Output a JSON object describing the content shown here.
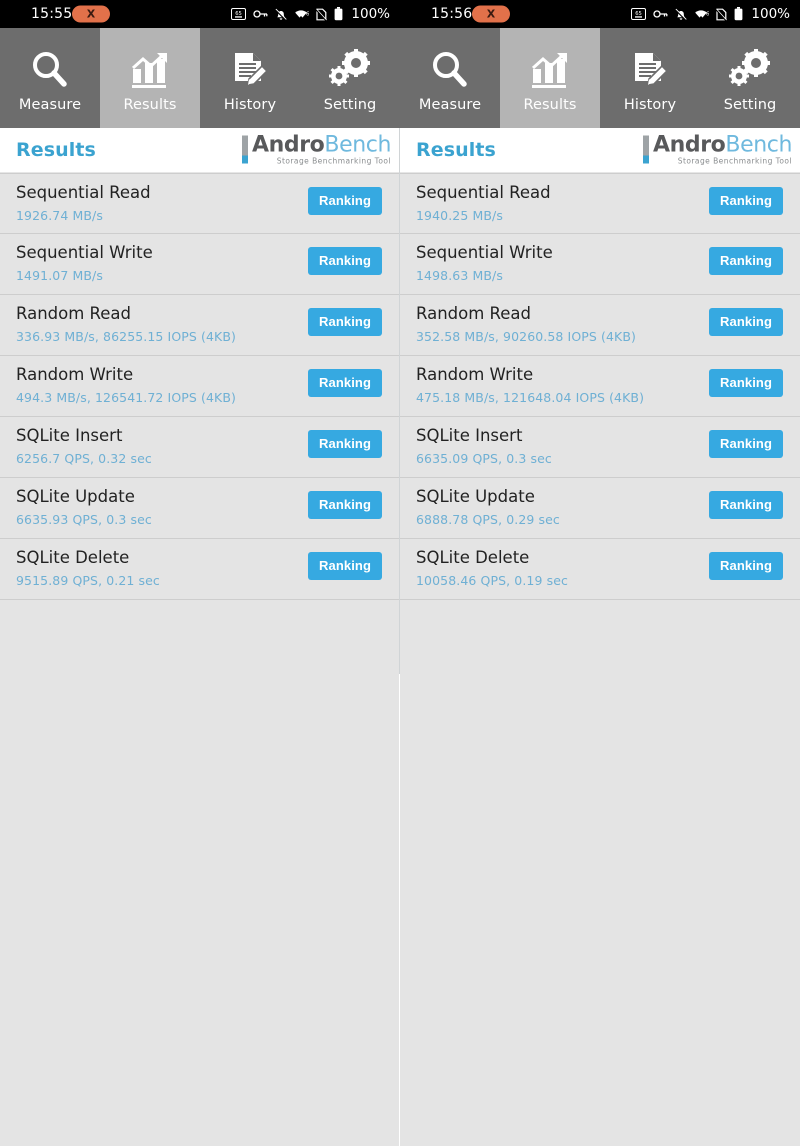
{
  "statusbar": {
    "left": {
      "time": "15:55",
      "pill_glyph": "X",
      "battery": "100%"
    },
    "right": {
      "time": "15:56",
      "pill_glyph": "X",
      "battery": "100%"
    },
    "icons": [
      "subtitle-icon",
      "key-icon",
      "notifications-off-icon",
      "wifi-icon",
      "sim-off-icon",
      "battery-icon"
    ]
  },
  "tabs": [
    {
      "label": "Measure",
      "icon": "magnifier-icon",
      "active": false
    },
    {
      "label": "Results",
      "icon": "bar-chart-icon",
      "active": true
    },
    {
      "label": "History",
      "icon": "document-pencil-icon",
      "active": false
    },
    {
      "label": "Setting",
      "icon": "gears-icon",
      "active": false
    },
    {
      "label": "Measure",
      "icon": "magnifier-icon",
      "active": false
    },
    {
      "label": "Results",
      "icon": "bar-chart-icon",
      "active": true
    },
    {
      "label": "History",
      "icon": "document-pencil-icon",
      "active": false
    },
    {
      "label": "Setting",
      "icon": "gears-icon",
      "active": false
    }
  ],
  "logo": {
    "word_a": "Andro",
    "word_b": "Bench",
    "subtitle": "Storage Benchmarking Tool"
  },
  "colors": {
    "accent": "#36a9e1",
    "value_text": "#6fb0d4",
    "title": "#3ba3d0",
    "tab_bg": "#6d6d6d",
    "tab_active_bg": "#b4b4b4",
    "row_bg": "#e4e4e4"
  },
  "panels": [
    {
      "title": "Results",
      "rank_label": "Ranking",
      "rows": [
        {
          "name": "Sequential Read",
          "value": "1926.74 MB/s"
        },
        {
          "name": "Sequential Write",
          "value": "1491.07 MB/s"
        },
        {
          "name": "Random Read",
          "value": "336.93 MB/s, 86255.15 IOPS (4KB)"
        },
        {
          "name": "Random Write",
          "value": "494.3 MB/s, 126541.72 IOPS (4KB)"
        },
        {
          "name": "SQLite Insert",
          "value": "6256.7 QPS, 0.32 sec"
        },
        {
          "name": "SQLite Update",
          "value": "6635.93 QPS, 0.3 sec"
        },
        {
          "name": "SQLite Delete",
          "value": "9515.89 QPS, 0.21 sec"
        }
      ]
    },
    {
      "title": "Results",
      "rank_label": "Ranking",
      "rows": [
        {
          "name": "Sequential Read",
          "value": "1940.25 MB/s"
        },
        {
          "name": "Sequential Write",
          "value": "1498.63 MB/s"
        },
        {
          "name": "Random Read",
          "value": "352.58 MB/s, 90260.58 IOPS (4KB)"
        },
        {
          "name": "Random Write",
          "value": "475.18 MB/s, 121648.04 IOPS (4KB)"
        },
        {
          "name": "SQLite Insert",
          "value": "6635.09 QPS, 0.3 sec"
        },
        {
          "name": "SQLite Update",
          "value": "6888.78 QPS, 0.29 sec"
        },
        {
          "name": "SQLite Delete",
          "value": "10058.46 QPS, 0.19 sec"
        }
      ]
    }
  ]
}
